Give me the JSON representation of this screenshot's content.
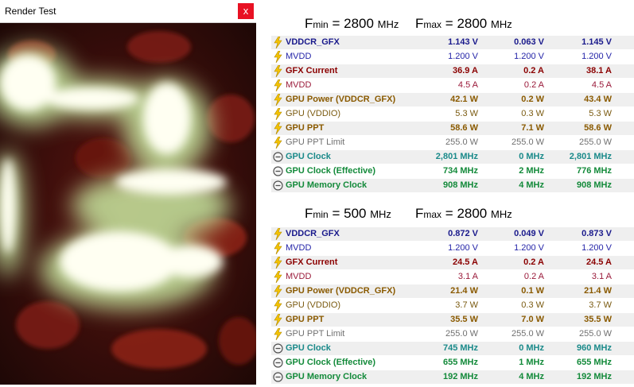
{
  "window": {
    "title": "Render Test",
    "close_glyph": "x",
    "close_color": "#e81123"
  },
  "sections": [
    {
      "fmin_label": "F",
      "fmin_sub": "min",
      "fmin_value": "2800",
      "fmin_unit": "MHz",
      "fmax_label": "F",
      "fmax_sub": "max",
      "fmax_value": "2800",
      "fmax_unit": "MHz",
      "rows": [
        {
          "icon": "lightning-icon",
          "label": "VDDCR_GFX",
          "v1": "1.143 V",
          "v2": "0.063 V",
          "v3": "1.145 V",
          "style": "navy"
        },
        {
          "icon": "lightning-icon",
          "label": "MVDD",
          "v1": "1.200 V",
          "v2": "1.200 V",
          "v3": "1.200 V",
          "style": "blue"
        },
        {
          "icon": "lightning-icon",
          "label": "GFX  Current",
          "v1": "36.9 A",
          "v2": "0.2 A",
          "v3": "38.1 A",
          "style": "red"
        },
        {
          "icon": "lightning-icon",
          "label": "MVDD",
          "v1": "4.5 A",
          "v2": "0.2 A",
          "v3": "4.5 A",
          "style": "dred"
        },
        {
          "icon": "lightning-icon",
          "label": "GPU Power (VDDCR_GFX)",
          "v1": "42.1 W",
          "v2": "0.2 W",
          "v3": "43.4 W",
          "style": "brown"
        },
        {
          "icon": "lightning-icon",
          "label": "GPU (VDDIO)",
          "v1": "5.3 W",
          "v2": "0.3 W",
          "v3": "5.3 W",
          "style": "olive"
        },
        {
          "icon": "lightning-icon",
          "label": "GPU PPT",
          "v1": "58.6 W",
          "v2": "7.1 W",
          "v3": "58.6 W",
          "style": "brown"
        },
        {
          "icon": "lightning-icon",
          "label": "GPU PPT Limit",
          "v1": "255.0 W",
          "v2": "255.0 W",
          "v3": "255.0 W",
          "style": "gray"
        },
        {
          "icon": "clock-icon",
          "label": "GPU Clock",
          "v1": "2,801 MHz",
          "v2": "0 MHz",
          "v3": "2,801 MHz",
          "style": "teal"
        },
        {
          "icon": "clock-icon",
          "label": "GPU Clock (Effective)",
          "v1": "734 MHz",
          "v2": "2 MHz",
          "v3": "776 MHz",
          "style": "green"
        },
        {
          "icon": "clock-icon",
          "label": "GPU Memory Clock",
          "v1": "908 MHz",
          "v2": "4 MHz",
          "v3": "908 MHz",
          "style": "green"
        }
      ]
    },
    {
      "fmin_label": "F",
      "fmin_sub": "min",
      "fmin_value": "500",
      "fmin_unit": "MHz",
      "fmax_label": "F",
      "fmax_sub": "max",
      "fmax_value": "2800",
      "fmax_unit": "MHz",
      "rows": [
        {
          "icon": "lightning-icon",
          "label": "VDDCR_GFX",
          "v1": "0.872 V",
          "v2": "0.049 V",
          "v3": "0.873 V",
          "style": "navy"
        },
        {
          "icon": "lightning-icon",
          "label": "MVDD",
          "v1": "1.200 V",
          "v2": "1.200 V",
          "v3": "1.200 V",
          "style": "blue"
        },
        {
          "icon": "lightning-icon",
          "label": "GFX  Current",
          "v1": "24.5 A",
          "v2": "0.2 A",
          "v3": "24.5 A",
          "style": "red"
        },
        {
          "icon": "lightning-icon",
          "label": "MVDD",
          "v1": "3.1 A",
          "v2": "0.2 A",
          "v3": "3.1 A",
          "style": "dred"
        },
        {
          "icon": "lightning-icon",
          "label": "GPU Power (VDDCR_GFX)",
          "v1": "21.4 W",
          "v2": "0.1 W",
          "v3": "21.4 W",
          "style": "brown"
        },
        {
          "icon": "lightning-icon",
          "label": "GPU (VDDIO)",
          "v1": "3.7 W",
          "v2": "0.3 W",
          "v3": "3.7 W",
          "style": "olive"
        },
        {
          "icon": "lightning-icon",
          "label": "GPU PPT",
          "v1": "35.5 W",
          "v2": "7.0 W",
          "v3": "35.5 W",
          "style": "brown"
        },
        {
          "icon": "lightning-icon",
          "label": "GPU PPT Limit",
          "v1": "255.0 W",
          "v2": "255.0 W",
          "v3": "255.0 W",
          "style": "gray"
        },
        {
          "icon": "clock-icon",
          "label": "GPU Clock",
          "v1": "745 MHz",
          "v2": "0 MHz",
          "v3": "960 MHz",
          "style": "teal"
        },
        {
          "icon": "clock-icon",
          "label": "GPU Clock (Effective)",
          "v1": "655 MHz",
          "v2": "1 MHz",
          "v3": "655 MHz",
          "style": "green"
        },
        {
          "icon": "clock-icon",
          "label": "GPU Memory Clock",
          "v1": "192 MHz",
          "v2": "4 MHz",
          "v3": "192 MHz",
          "style": "green"
        }
      ]
    }
  ]
}
